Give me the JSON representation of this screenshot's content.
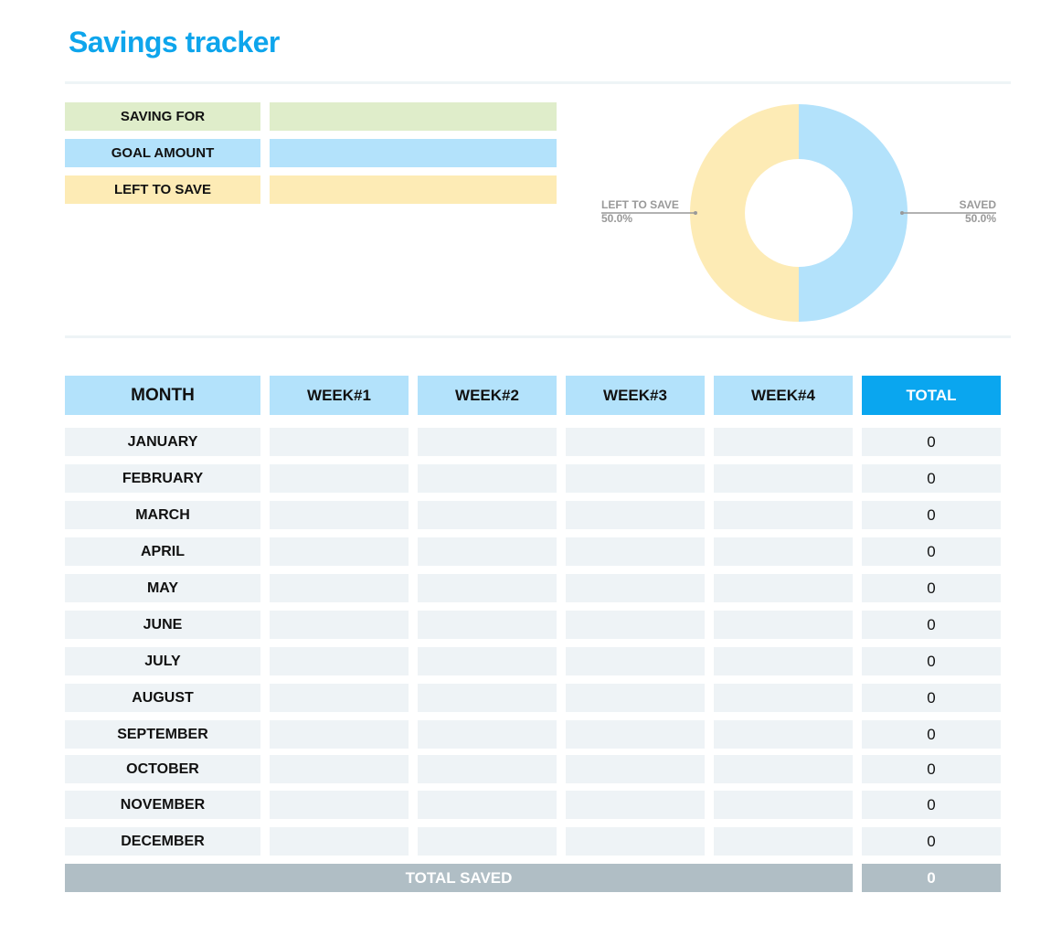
{
  "page": {
    "title": "Savings tracker"
  },
  "info": [
    {
      "label": "SAVING FOR",
      "value": "",
      "bg": "#dfedca"
    },
    {
      "label": "GOAL AMOUNT",
      "value": "",
      "bg": "#b3e2fb"
    },
    {
      "label": "LEFT TO SAVE",
      "value": "",
      "bg": "#fdebb5"
    }
  ],
  "chart_data": {
    "type": "pie",
    "style": "donut",
    "title": "",
    "slices": [
      {
        "name": "SAVED",
        "value": 50.0,
        "label": "50.0%",
        "color": "#b3e2fb"
      },
      {
        "name": "LEFT TO SAVE",
        "value": 50.0,
        "label": "50.0%",
        "color": "#fdebb5"
      }
    ],
    "label_color": "#999999"
  },
  "table": {
    "headers": [
      "MONTH",
      "WEEK#1",
      "WEEK#2",
      "WEEK#3",
      "WEEK#4",
      "TOTAL"
    ],
    "rows": [
      {
        "month": "JANUARY",
        "weeks": [
          "",
          "",
          "",
          ""
        ],
        "total": "0"
      },
      {
        "month": "FEBRUARY",
        "weeks": [
          "",
          "",
          "",
          ""
        ],
        "total": "0"
      },
      {
        "month": "MARCH",
        "weeks": [
          "",
          "",
          "",
          ""
        ],
        "total": "0"
      },
      {
        "month": "APRIL",
        "weeks": [
          "",
          "",
          "",
          ""
        ],
        "total": "0"
      },
      {
        "month": "MAY",
        "weeks": [
          "",
          "",
          "",
          ""
        ],
        "total": "0"
      },
      {
        "month": "JUNE",
        "weeks": [
          "",
          "",
          "",
          ""
        ],
        "total": "0"
      },
      {
        "month": "JULY",
        "weeks": [
          "",
          "",
          "",
          ""
        ],
        "total": "0"
      },
      {
        "month": "AUGUST",
        "weeks": [
          "",
          "",
          "",
          ""
        ],
        "total": "0"
      },
      {
        "month": "SEPTEMBER",
        "weeks": [
          "",
          "",
          "",
          ""
        ],
        "total": "0"
      },
      {
        "month": "OCTOBER",
        "weeks": [
          "",
          "",
          "",
          ""
        ],
        "total": "0"
      },
      {
        "month": "NOVEMBER",
        "weeks": [
          "",
          "",
          "",
          ""
        ],
        "total": "0"
      },
      {
        "month": "DECEMBER",
        "weeks": [
          "",
          "",
          "",
          ""
        ],
        "total": "0"
      }
    ],
    "footer": {
      "label": "TOTAL SAVED",
      "total": "0"
    }
  }
}
